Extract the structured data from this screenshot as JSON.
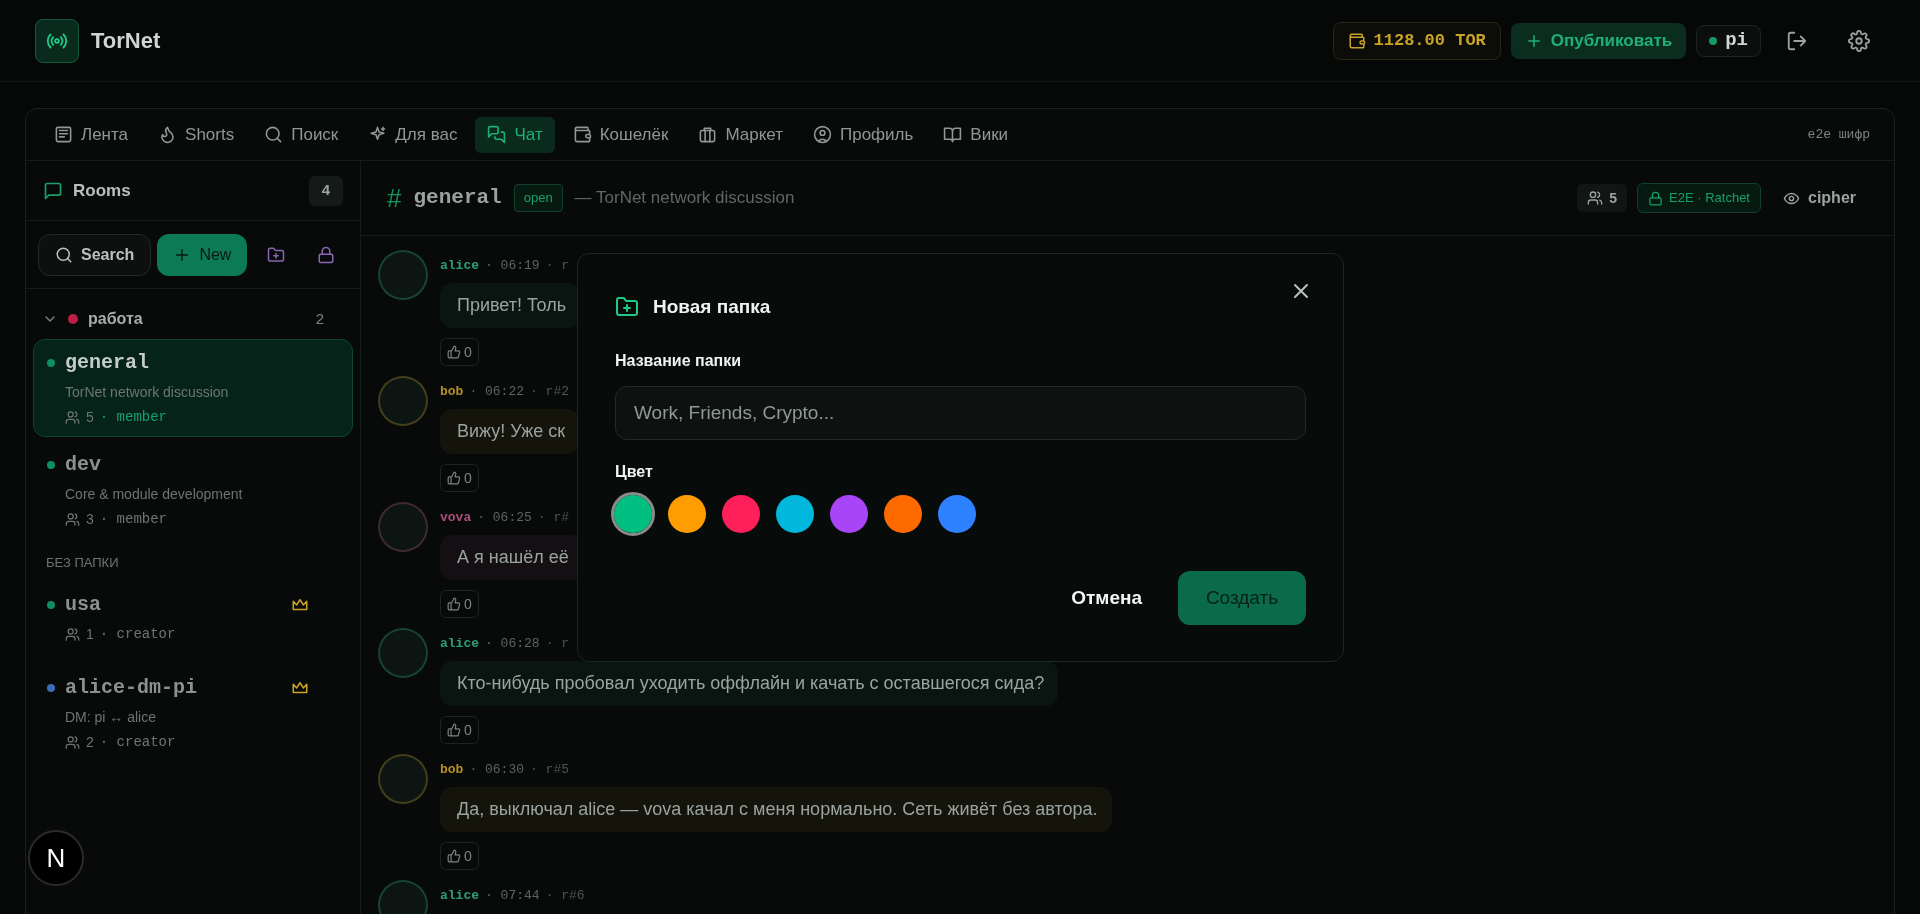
{
  "header": {
    "brand": "TorNet",
    "balance": "1128.00 TOR",
    "publish_button": "Опубликовать",
    "user": {
      "name": "pi",
      "online": true
    }
  },
  "nav": {
    "tabs": [
      {
        "label": "Лента",
        "selected": false
      },
      {
        "label": "Shorts",
        "selected": false
      },
      {
        "label": "Поиск",
        "selected": false
      },
      {
        "label": "Для вас",
        "selected": false
      },
      {
        "label": "Чат",
        "selected": true
      },
      {
        "label": "Кошелёк",
        "selected": false
      },
      {
        "label": "Маркет",
        "selected": false
      },
      {
        "label": "Профиль",
        "selected": false
      },
      {
        "label": "Вики",
        "selected": false
      }
    ],
    "note": "e2e шифр"
  },
  "sidebar": {
    "title": "Rooms",
    "count": "4",
    "search_button": "Search",
    "new_button": "New",
    "folders": [
      {
        "name": "работа",
        "color": "#be1e45",
        "count": "2",
        "expanded": true,
        "rooms": [
          {
            "name": "general",
            "description": "TorNet network discussion",
            "members": "5",
            "role": "· member",
            "selected": true,
            "owner": false,
            "color": "#0f8f5f"
          },
          {
            "name": "dev",
            "description": "Core & module development",
            "members": "3",
            "role": "· member",
            "selected": false,
            "owner": false,
            "color": "#0f8f5f"
          }
        ]
      }
    ],
    "unfiled_label": "БЕЗ ПАПКИ",
    "unfiled_rooms": [
      {
        "name": "usa",
        "members": "1",
        "role": "· creator",
        "selected": false,
        "owner": true,
        "color": "#0f8f5f"
      },
      {
        "name": "alice-dm-pi",
        "description": "DM: pi ↔ alice",
        "members": "2",
        "role": "· creator",
        "selected": false,
        "owner": true,
        "color": "#3a6fb8"
      }
    ]
  },
  "chat": {
    "hash": "#",
    "channel": "general",
    "access": "open",
    "topic": "— TorNet network discussion",
    "members": "5",
    "encryption": "E2E · Ratchet",
    "view_mode": "cipher",
    "messages": [
      {
        "author": "alice",
        "time": "· 06:19",
        "ref": "· r",
        "text": "Привет! Толь",
        "likes": "0",
        "color": "#2e9e74"
      },
      {
        "author": "bob",
        "time": "· 06:22",
        "ref": "· r#2",
        "text": "Вижу! Уже ск",
        "likes": "0",
        "color": "#b8902a"
      },
      {
        "author": "vova",
        "time": "· 06:25",
        "ref": "· r#",
        "text": "А я нашёл её",
        "likes": "0",
        "color": "#a8507a"
      },
      {
        "author": "alice",
        "time": "· 06:28",
        "ref": "· r",
        "text": "Кто-нибудь пробовал уходить оффлайн и качать с оставшегося сида?",
        "likes": "0",
        "color": "#2e9e74"
      },
      {
        "author": "bob",
        "time": "· 06:30",
        "ref": "· r#5",
        "text": "Да, выключал alice — vova качал с меня нормально. Сеть живёт без автора.",
        "likes": "0",
        "color": "#b8902a"
      },
      {
        "author": "alice",
        "time": "· 07:44",
        "ref": "· r#6",
        "color": "#2e9e74"
      }
    ]
  },
  "dev_badge": "N",
  "modal": {
    "title": "Новая папка",
    "name_label": "Название папки",
    "name_placeholder": "Work, Friends, Crypto...",
    "color_label": "Цвет",
    "colors": [
      {
        "color": "#00bf80",
        "selected": true
      },
      {
        "color": "#ff9d00",
        "selected": false
      },
      {
        "color": "#ff1f5a",
        "selected": false
      },
      {
        "color": "#00b8db",
        "selected": false
      },
      {
        "color": "#a845f7",
        "selected": false
      },
      {
        "color": "#ff6a00",
        "selected": false
      },
      {
        "color": "#2f82ff",
        "selected": false
      }
    ],
    "cancel_button": "Отмена",
    "create_button": "Создать"
  }
}
